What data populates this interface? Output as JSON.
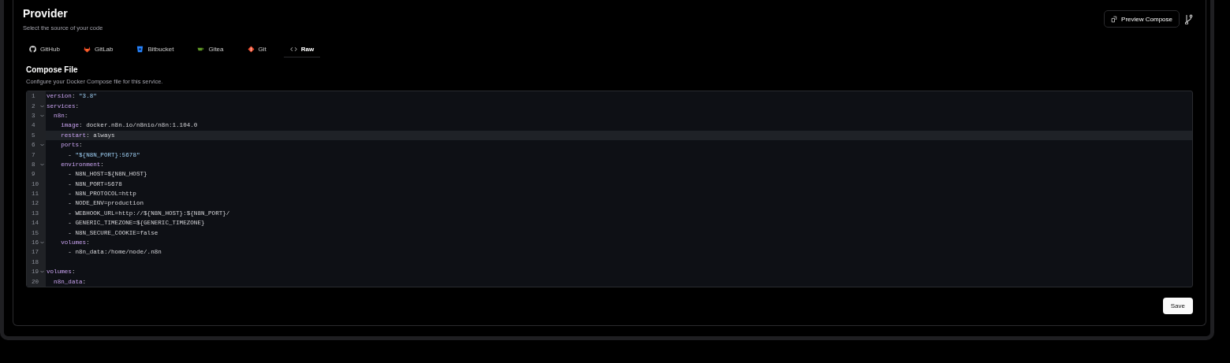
{
  "provider": {
    "title": "Provider",
    "subtitle": "Select the source of your code",
    "preview_button": "Preview Compose"
  },
  "tabs": [
    {
      "label": "GitHub",
      "kind": "github",
      "selected": false
    },
    {
      "label": "GitLab",
      "kind": "gitlab",
      "selected": false
    },
    {
      "label": "Bitbucket",
      "kind": "bitbucket",
      "selected": false
    },
    {
      "label": "Gitea",
      "kind": "gitea",
      "selected": false
    },
    {
      "label": "Git",
      "kind": "git",
      "selected": false
    },
    {
      "label": "Raw",
      "kind": "code",
      "selected": true
    }
  ],
  "compose": {
    "title": "Compose File",
    "description": "Configure your Docker Compose file for this service."
  },
  "editor": {
    "lines": [
      {
        "number": "1",
        "foldable": false,
        "active": false,
        "segments": [
          {
            "kind": "key",
            "text": "version"
          },
          {
            "kind": "plain",
            "text": ": "
          },
          {
            "kind": "string",
            "text": "\"3.8\""
          }
        ]
      },
      {
        "number": "2",
        "foldable": true,
        "active": false,
        "segments": [
          {
            "kind": "key",
            "text": "services"
          },
          {
            "kind": "plain",
            "text": ":"
          }
        ]
      },
      {
        "number": "3",
        "foldable": true,
        "active": false,
        "segments": [
          {
            "kind": "key",
            "text": "  n8n"
          },
          {
            "kind": "plain",
            "text": ":"
          }
        ]
      },
      {
        "number": "4",
        "foldable": false,
        "active": false,
        "segments": [
          {
            "kind": "key",
            "text": "    image"
          },
          {
            "kind": "plain",
            "text": ": docker.n8n.io/n8nio/n8n:1.104.0"
          }
        ]
      },
      {
        "number": "5",
        "foldable": false,
        "active": true,
        "segments": [
          {
            "kind": "key",
            "text": "    restart"
          },
          {
            "kind": "plain",
            "text": ": always"
          }
        ]
      },
      {
        "number": "6",
        "foldable": true,
        "active": false,
        "segments": [
          {
            "kind": "key",
            "text": "    ports"
          },
          {
            "kind": "plain",
            "text": ":"
          }
        ]
      },
      {
        "number": "7",
        "foldable": false,
        "active": false,
        "segments": [
          {
            "kind": "plain",
            "text": "      - "
          },
          {
            "kind": "string",
            "text": "\"${N8N_PORT}:5678\""
          }
        ]
      },
      {
        "number": "8",
        "foldable": true,
        "active": false,
        "segments": [
          {
            "kind": "key",
            "text": "    environment"
          },
          {
            "kind": "plain",
            "text": ":"
          }
        ]
      },
      {
        "number": "9",
        "foldable": false,
        "active": false,
        "segments": [
          {
            "kind": "plain",
            "text": "      - N8N_HOST=${N8N_HOST}"
          }
        ]
      },
      {
        "number": "10",
        "foldable": false,
        "active": false,
        "segments": [
          {
            "kind": "plain",
            "text": "      - N8N_PORT=5678"
          }
        ]
      },
      {
        "number": "11",
        "foldable": false,
        "active": false,
        "segments": [
          {
            "kind": "plain",
            "text": "      - N8N_PROTOCOL=http"
          }
        ]
      },
      {
        "number": "12",
        "foldable": false,
        "active": false,
        "segments": [
          {
            "kind": "plain",
            "text": "      - NODE_ENV=production"
          }
        ]
      },
      {
        "number": "13",
        "foldable": false,
        "active": false,
        "segments": [
          {
            "kind": "plain",
            "text": "      - WEBHOOK_URL=http://${N8N_HOST}:${N8N_PORT}/"
          }
        ]
      },
      {
        "number": "14",
        "foldable": false,
        "active": false,
        "segments": [
          {
            "kind": "plain",
            "text": "      - GENERIC_TIMEZONE=${GENERIC_TIMEZONE}"
          }
        ]
      },
      {
        "number": "15",
        "foldable": false,
        "active": false,
        "segments": [
          {
            "kind": "plain",
            "text": "      - N8N_SECURE_COOKIE=false"
          }
        ]
      },
      {
        "number": "16",
        "foldable": true,
        "active": false,
        "segments": [
          {
            "kind": "key",
            "text": "    volumes"
          },
          {
            "kind": "plain",
            "text": ":"
          }
        ]
      },
      {
        "number": "17",
        "foldable": false,
        "active": false,
        "segments": [
          {
            "kind": "plain",
            "text": "      - n8n_data:/home/node/.n8n"
          }
        ]
      },
      {
        "number": "18",
        "foldable": false,
        "active": false
      },
      {
        "number": "19",
        "foldable": true,
        "active": false,
        "segments": [
          {
            "kind": "key",
            "text": "volumes"
          },
          {
            "kind": "plain",
            "text": ":"
          }
        ]
      },
      {
        "number": "20",
        "foldable": false,
        "active": false,
        "segments": [
          {
            "kind": "key",
            "text": "  n8n_data"
          },
          {
            "kind": "plain",
            "text": ":"
          }
        ]
      }
    ]
  },
  "save_button": "Save"
}
